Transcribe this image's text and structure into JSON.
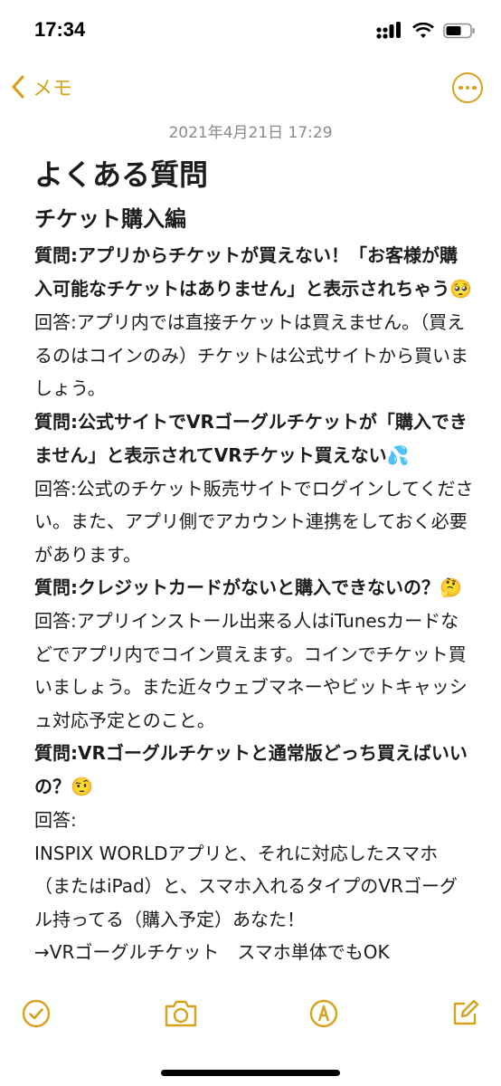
{
  "status_bar": {
    "time": "17:34"
  },
  "nav": {
    "back_label": "メモ"
  },
  "note": {
    "date": "2021年4月21日 17:29",
    "title": "よくある質問",
    "subtitle": "チケット購入編",
    "qa": [
      {
        "q": "質問:アプリからチケットが買えない！「お客様が購入可能なチケットはありません」と表示されちゃう",
        "q_emoji": "🥺",
        "a": "回答:アプリ内では直接チケットは買えません。（買えるのはコインのみ）チケットは公式サイトから買いましょう。"
      },
      {
        "q": "質問:公式サイトでVRゴーグルチケットが「購入できません」と表示されてVRチケット買えない",
        "q_emoji": "💦",
        "a": "回答:公式のチケット販売サイトでログインしてください。また、アプリ側でアカウント連携をしておく必要があります。"
      },
      {
        "q": "質問:クレジットカードがないと購入できないの？",
        "q_emoji": "🤔",
        "a": "回答:アプリインストール出来る人はiTunesカードなどでアプリ内でコイン買えます。コインでチケット買いましょう。また近々ウェブマネーやビットキャッシュ対応予定とのこと。"
      },
      {
        "q": "質問:VRゴーグルチケットと通常版どっち買えばいいの？",
        "q_emoji": "🤨",
        "a": "回答:"
      }
    ],
    "overflow_lines": [
      "INSPIX WORLDアプリと、それに対応したスマホ（またはiPad）と、スマホ入れるタイプのVRゴーグル持ってる（購入予定）あなた！",
      "→VRゴーグルチケット　スマホ単体でもOK"
    ]
  },
  "toolbar": {
    "icons": [
      "checklist-icon",
      "camera-icon",
      "markup-icon",
      "compose-icon"
    ]
  },
  "colors": {
    "accent": "#d6a11d",
    "text": "#1c1c1e",
    "secondary": "#8a8a8e"
  }
}
